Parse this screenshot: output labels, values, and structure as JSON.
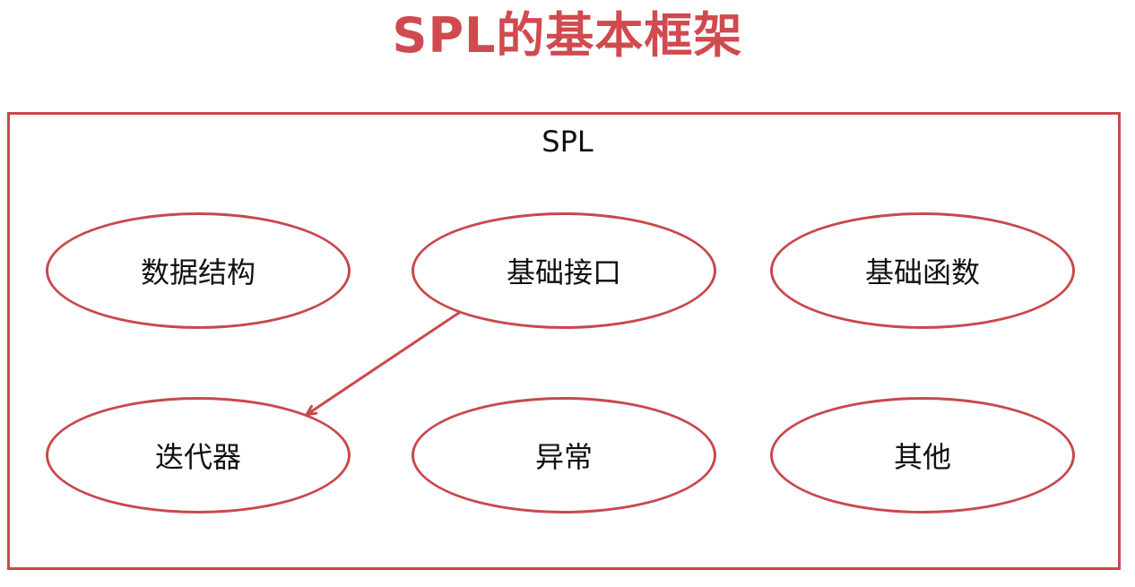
{
  "title": "SPL的基本框架",
  "container": {
    "label": "SPL"
  },
  "nodes": [
    {
      "label": "数据结构"
    },
    {
      "label": "基础接口"
    },
    {
      "label": "基础函数"
    },
    {
      "label": "迭代器"
    },
    {
      "label": "异常"
    },
    {
      "label": "其他"
    }
  ],
  "edges": [
    {
      "from": "基础接口",
      "to": "迭代器"
    }
  ],
  "colors": {
    "accent": "#d04a4f",
    "border": "#c9484d",
    "text": "#111111",
    "background": "#ffffff"
  }
}
